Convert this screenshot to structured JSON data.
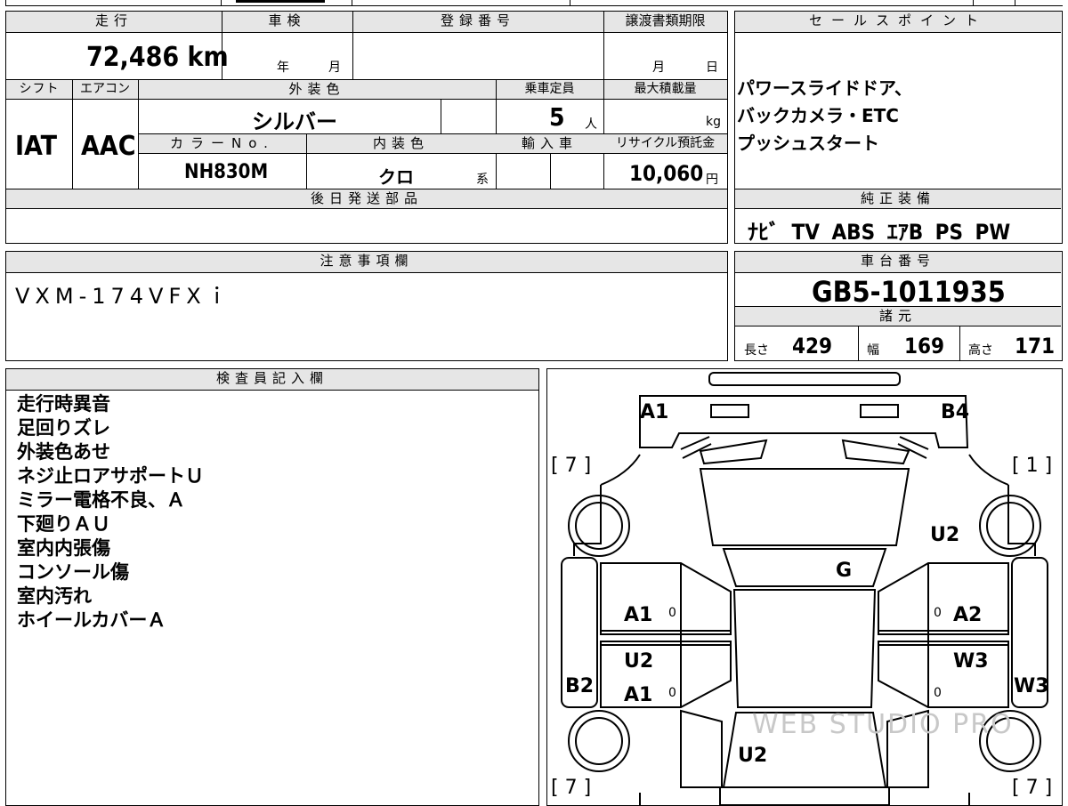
{
  "sheet": {
    "mileage_label": "走行",
    "mileage": "72,486 km",
    "inspection_label": "車検",
    "inspection_year_suffix": "年",
    "inspection_month_suffix": "月",
    "registration_label": "登録番号",
    "transfer_label": "譲渡書類期限",
    "transfer_month": "月",
    "transfer_day": "日",
    "shift_label": "シフト",
    "shift": "IAT",
    "ac_label": "エアコン",
    "ac": "AAC",
    "exterior_color_label": "外装色",
    "exterior_color": "シルバー",
    "capacity_label": "乗車定員",
    "capacity": "5",
    "capacity_unit": "人",
    "max_load_label": "最大積載量",
    "max_load_unit": "kg",
    "color_no_label": "カラーNo.",
    "color_no": "NH830M",
    "interior_color_label": "内装色",
    "interior_color": "クロ",
    "interior_suffix": "系",
    "import_label": "輸入車",
    "recycle_label": "リサイクル預託金",
    "recycle_fee": "10,060",
    "recycle_unit": "円",
    "later_parts_label": "後日発送部品",
    "sales_point_label": "セールスポイント",
    "sales_points": [
      "パワースライドドア、",
      "バックカメラ・ETC",
      "プッシュスタート"
    ],
    "equipment_label": "純正装備",
    "equipment": "ﾅﾋﾞ TV ABS ｴｱB PS PW",
    "notes_label": "注意事項欄",
    "notes": "VXM-174VFXｉ",
    "chassis_label": "車台番号",
    "chassis_no": "GB5-1011935",
    "specs_label": "諸元",
    "length_label": "長さ",
    "length": "429",
    "width_label": "幅",
    "width": "169",
    "height_label": "高さ",
    "height": "171",
    "inspector_label": "検査員記入欄",
    "inspector_notes": [
      "走行時異音",
      "足回りズレ",
      "外装色あせ",
      "ネジ止ロアサポートＵ",
      "ミラー電格不良、Ａ",
      "下廻りＡＵ",
      "室内内張傷",
      "コンソール傷",
      "室内汚れ",
      "ホイールカバーＡ"
    ]
  },
  "diagram": {
    "marks": {
      "front_left": "A1",
      "front_right": "B4",
      "bracket_tl": "[ 7 ]",
      "bracket_tr": "[ 1 ]",
      "bracket_bl": "[ 7 ]",
      "bracket_br": "[ 7 ]",
      "fender_r": "U2",
      "roof": "G",
      "door_fl": "A1",
      "door_fr": "A2",
      "door_rl_a": "U2",
      "door_rl_b": "A1",
      "door_rr": "W3",
      "side_l": "B2",
      "side_r": "W3",
      "rear": "U2",
      "zero": "0",
      "watermark": "WEB STUDIO PRO"
    }
  }
}
